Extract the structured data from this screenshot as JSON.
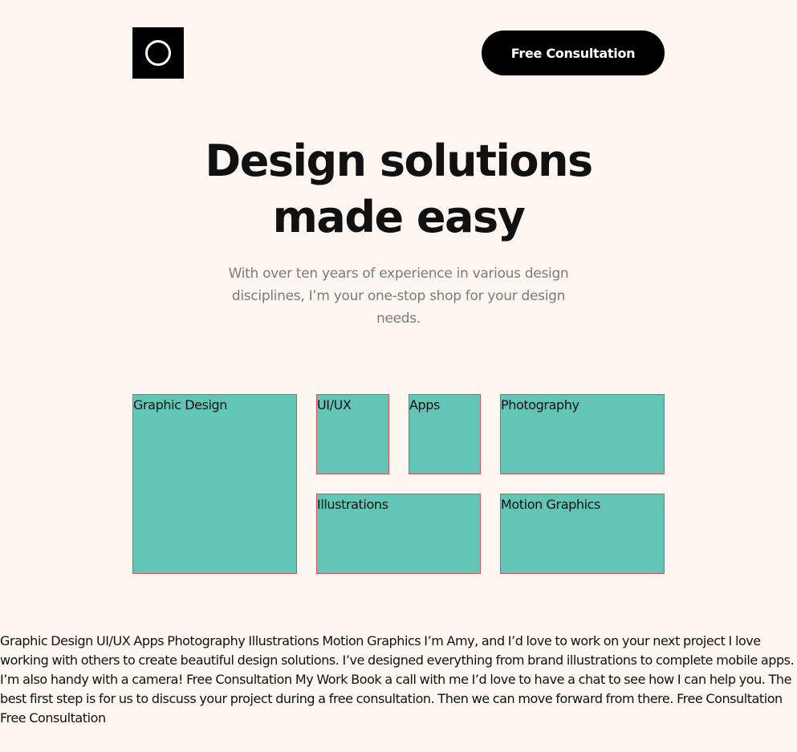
{
  "header": {
    "logo_icon": "ring-logo-icon",
    "cta_label": "Free Consultation"
  },
  "hero": {
    "title_line1": "Design solutions",
    "title_line2": "made easy",
    "subtitle": "With over ten years of experience in various design disciplines, I’m your one-stop shop for your design needs."
  },
  "services": {
    "tiles": [
      {
        "label": "Graphic Design"
      },
      {
        "label": "UI/UX"
      },
      {
        "label": "Apps"
      },
      {
        "label": "Photography"
      },
      {
        "label": "Illustrations"
      },
      {
        "label": "Motion Graphics"
      }
    ]
  },
  "footer": {
    "text": "Graphic Design UI/UX Apps Photography Illustrations Motion Graphics I’m Amy, and I’d love to work on your next project I love working with others to create beautiful design solutions. I’ve designed everything from brand illustrations to complete mobile apps. I’m also handy with a camera! Free Consultation My Work Book a call with me I’d love to have a chat to see how I can help you. The best first step is for us to discuss your project during a free consultation. Then we can move forward from there. Free Consultation Free Consultation"
  },
  "colors": {
    "background": "#fdf6f1",
    "tile_fill": "#63c5b6",
    "tile_outline": "#d9515a",
    "text_dark": "#111111",
    "text_muted": "#7b7b7b"
  }
}
